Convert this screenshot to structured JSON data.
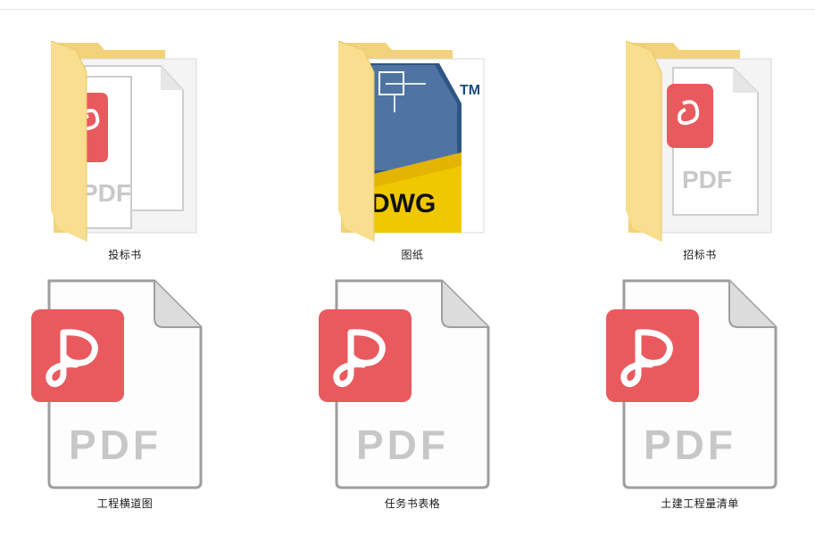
{
  "items": [
    {
      "label": "投标书",
      "type": "folder",
      "preview": "pdf"
    },
    {
      "label": "图纸",
      "type": "folder",
      "preview": "dwg"
    },
    {
      "label": "招标书",
      "type": "folder",
      "preview": "pdf"
    },
    {
      "label": "工程横道图",
      "type": "file",
      "preview": "pdf"
    },
    {
      "label": "任务书表格",
      "type": "file",
      "preview": "pdf"
    },
    {
      "label": "土建工程量清单",
      "type": "file",
      "preview": "pdf"
    }
  ],
  "icon_text": {
    "pdf": "PDF",
    "dwg": "DWG",
    "tm": "TM"
  },
  "colors": {
    "folder": "#f6dc8e",
    "folder_dark": "#e8c66a",
    "pdf_red": "#e95a5e",
    "pdf_text": "#c7c7c7",
    "dwg_blue": "#1f3f6e",
    "dwg_yellow": "#f0c800"
  }
}
